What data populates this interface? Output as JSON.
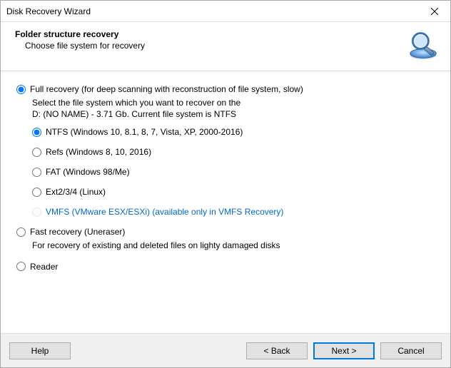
{
  "window": {
    "title": "Disk Recovery Wizard"
  },
  "header": {
    "title": "Folder structure recovery",
    "subtitle": "Choose file system for recovery"
  },
  "modes": {
    "full": {
      "label": "Full recovery (for deep scanning with reconstruction of file system, slow)",
      "desc_line1": "Select the file system which you want to recover on the",
      "desc_line2": "D: (NO NAME) - 3.71 Gb. Current file system is NTFS",
      "fs": {
        "ntfs": "NTFS (Windows 10, 8.1, 8, 7, Vista, XP, 2000-2016)",
        "refs": "Refs (Windows 8, 10, 2016)",
        "fat": "FAT (Windows 98/Me)",
        "ext": "Ext2/3/4 (Linux)",
        "vmfs": "VMFS (VMware ESX/ESXi) (available only in VMFS Recovery)"
      }
    },
    "fast": {
      "label": "Fast recovery (Uneraser)",
      "desc": "For recovery of existing and deleted files on lighty damaged disks"
    },
    "reader": {
      "label": "Reader"
    }
  },
  "buttons": {
    "help": "Help",
    "back": "< Back",
    "next": "Next >",
    "cancel": "Cancel"
  }
}
